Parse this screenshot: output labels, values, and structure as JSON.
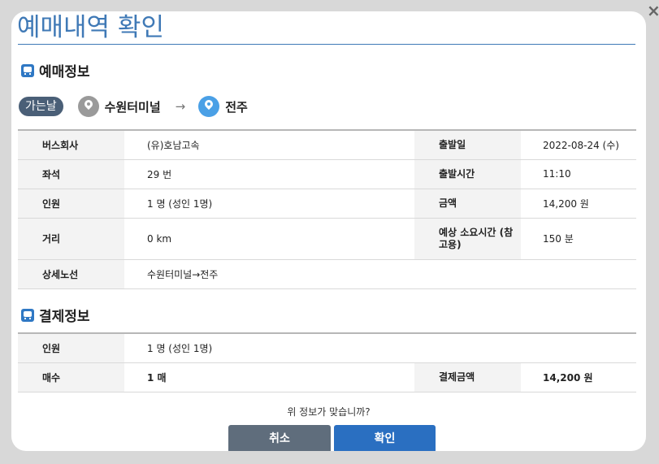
{
  "title": "예매내역 확인",
  "close_glyph": "×",
  "ticket_section": {
    "heading": "예매정보"
  },
  "route": {
    "badge": "가는날",
    "from": "수원터미널",
    "arrow": "→",
    "to": "전주"
  },
  "ticket_rows": [
    {
      "l1": "버스회사",
      "v1": "(유)호남고속",
      "l2": "출발일",
      "v2": "2022-08-24 (수)"
    },
    {
      "l1": "좌석",
      "v1": "29 번",
      "l2": "출발시간",
      "v2": "11:10"
    },
    {
      "l1": "인원",
      "v1": "1 명 (성인 1명)",
      "l2": "금액",
      "v2": "14,200 원"
    },
    {
      "l1": "거리",
      "v1": "0 km",
      "l2": "예상 소요시간 (참고용)",
      "v2": "150 분"
    },
    {
      "l1": "상세노선",
      "v1": "수원터미널→전주"
    }
  ],
  "payment_section": {
    "heading": "결제정보"
  },
  "payment_rows": [
    {
      "l1": "인원",
      "v1": "1 명 (성인 1명)"
    },
    {
      "l1": "매수",
      "v1": "1 매",
      "l2": "결제금액",
      "v2": "14,200 원"
    }
  ],
  "question": "위 정보가 맞습니까?",
  "buttons": {
    "cancel": "취소",
    "confirm": "확인"
  },
  "colors": {
    "accent": "#3f79b6",
    "cancel_button": "#5f6d7c",
    "confirm_button": "#2a6fc1"
  }
}
